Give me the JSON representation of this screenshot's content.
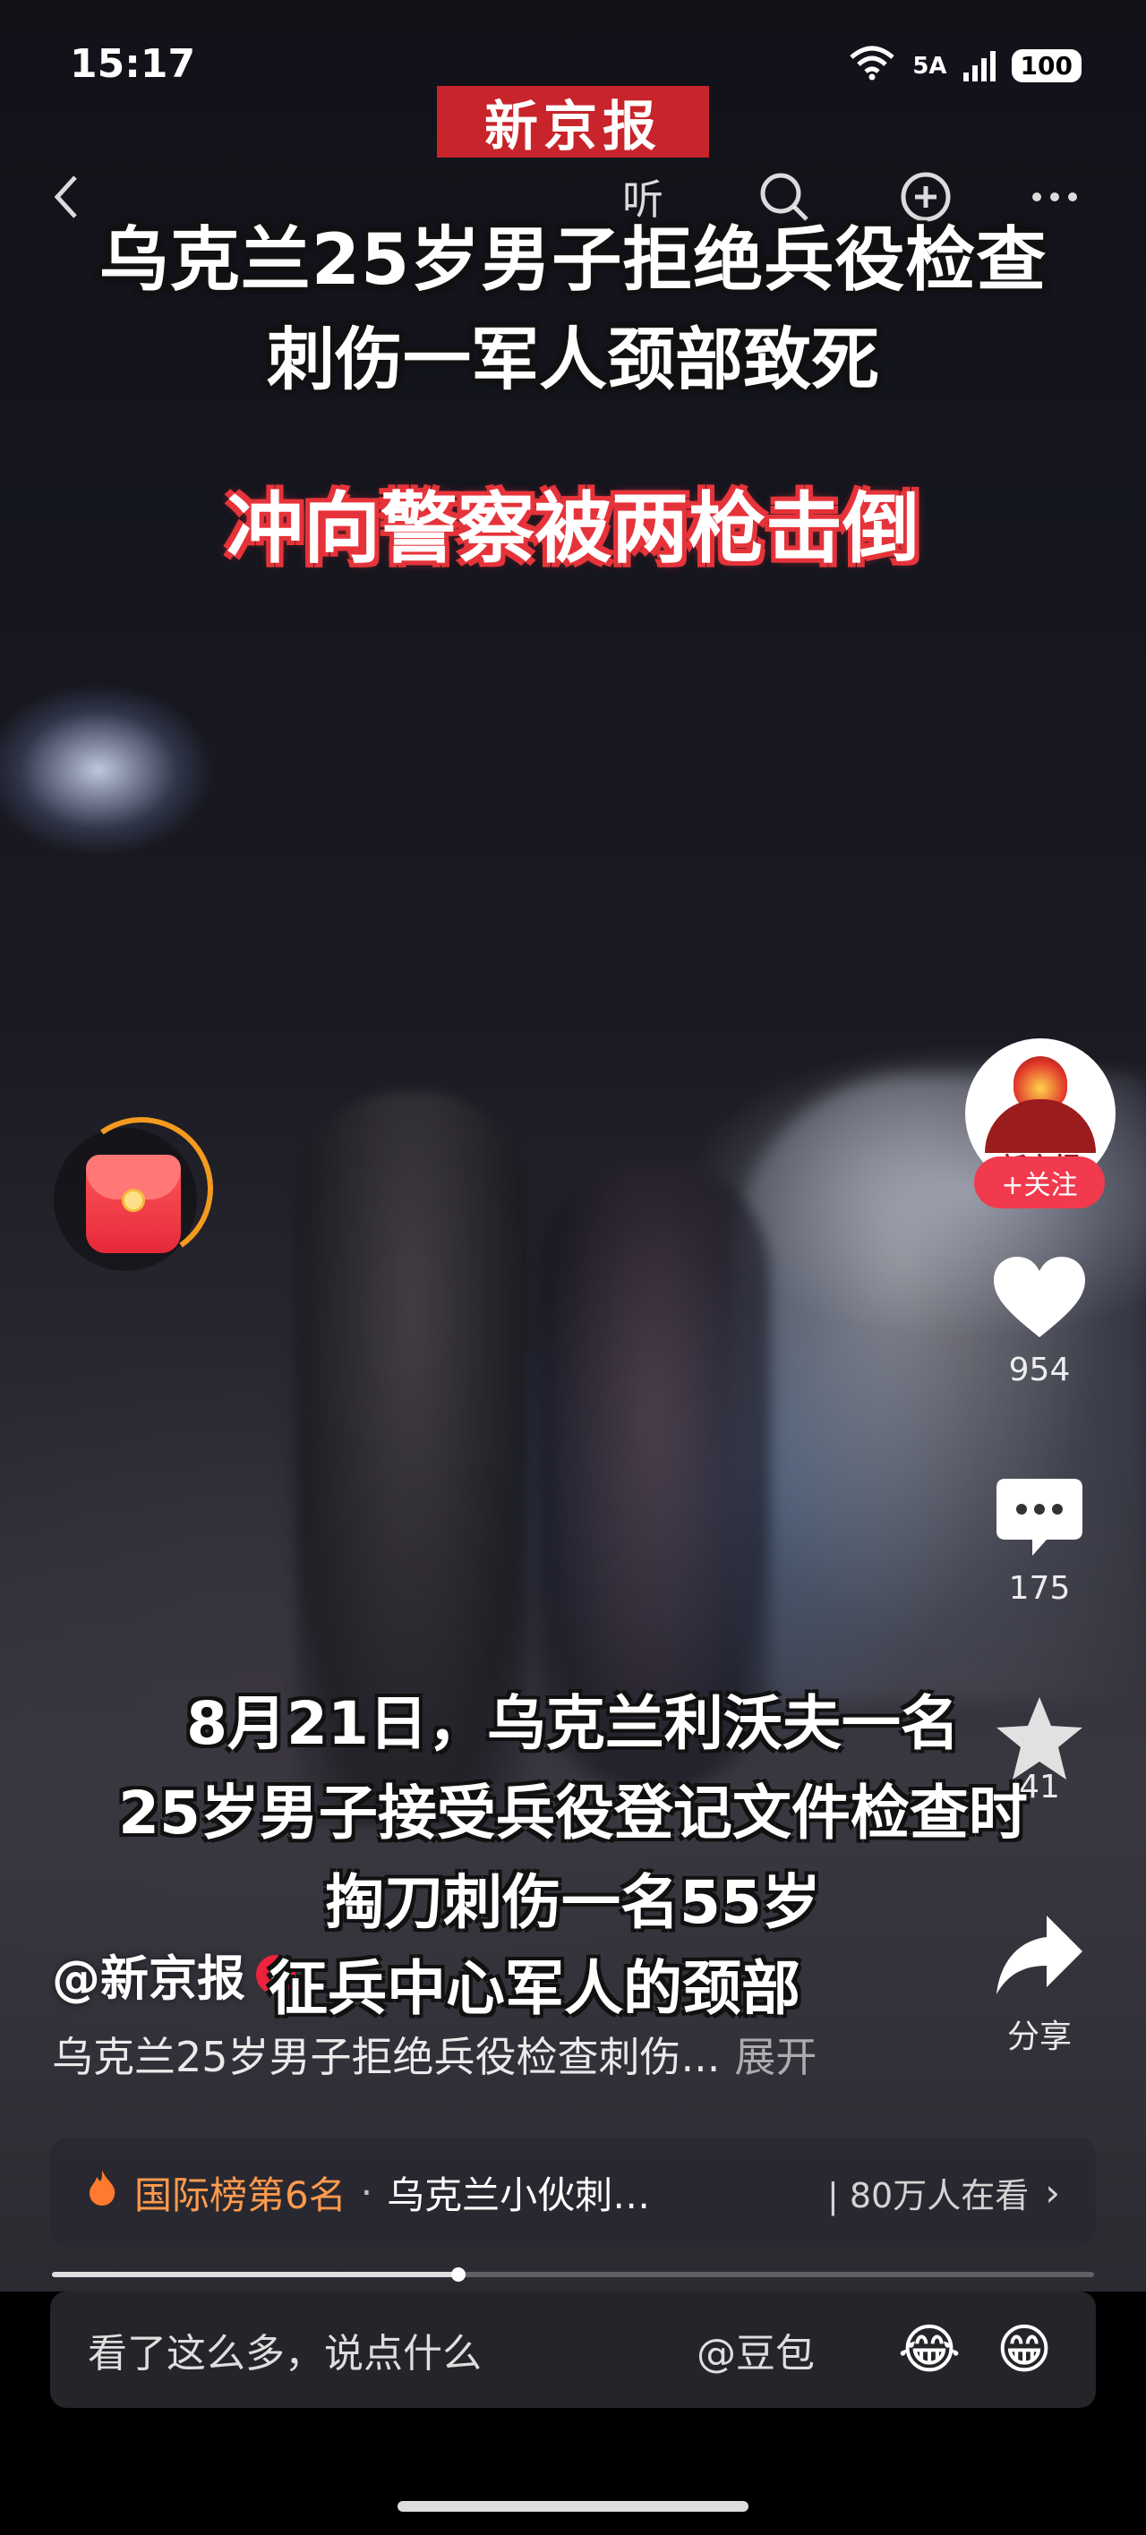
{
  "status_bar": {
    "time": "15:17",
    "wifi_label": "6",
    "network": "5A",
    "battery": "100"
  },
  "nav": {
    "back_icon": "chevron-left-icon",
    "listen_label": "听",
    "search_icon": "search-icon",
    "add_icon": "plus-circle-icon",
    "more_icon": "more-horizontal-icon"
  },
  "video": {
    "logo_text": "新京报",
    "title_line1": "乌克兰25岁男子拒绝兵役检查",
    "title_line2": "刺伤一军人颈部致死",
    "headline_red": "冲向警察被两枪击倒",
    "subtitle_lines": [
      "8月21日，乌克兰利沃夫一名",
      "25岁男子接受兵役登记文件检查时",
      "掏刀刺伤一名55岁",
      "征兵中心军人的颈部"
    ]
  },
  "sidebar": {
    "avatar_text": "新京报",
    "follow_label": "+关注",
    "likes": "954",
    "comments": "175",
    "favorites": "41",
    "share_label": "分享"
  },
  "info": {
    "author": "@新京报",
    "verify_badge": "v",
    "description": "乌克兰25岁男子拒绝兵役检查刺伤...",
    "expand_label": "展开"
  },
  "rank": {
    "label": "国际榜第6名",
    "separator": "·",
    "topic": "乌克兰小伙刺…",
    "viewers": "| 80万人在看",
    "chevron": "›"
  },
  "progress": {
    "fraction": 0.39
  },
  "comment": {
    "placeholder": "看了这么多，说点什么",
    "at_label": "@豆包",
    "emoji1": "😂",
    "emoji2": "😁"
  },
  "colors": {
    "accent_red": "#f23a4f",
    "logo_red": "#c8242b",
    "rank_orange": "#ff9a4d"
  }
}
